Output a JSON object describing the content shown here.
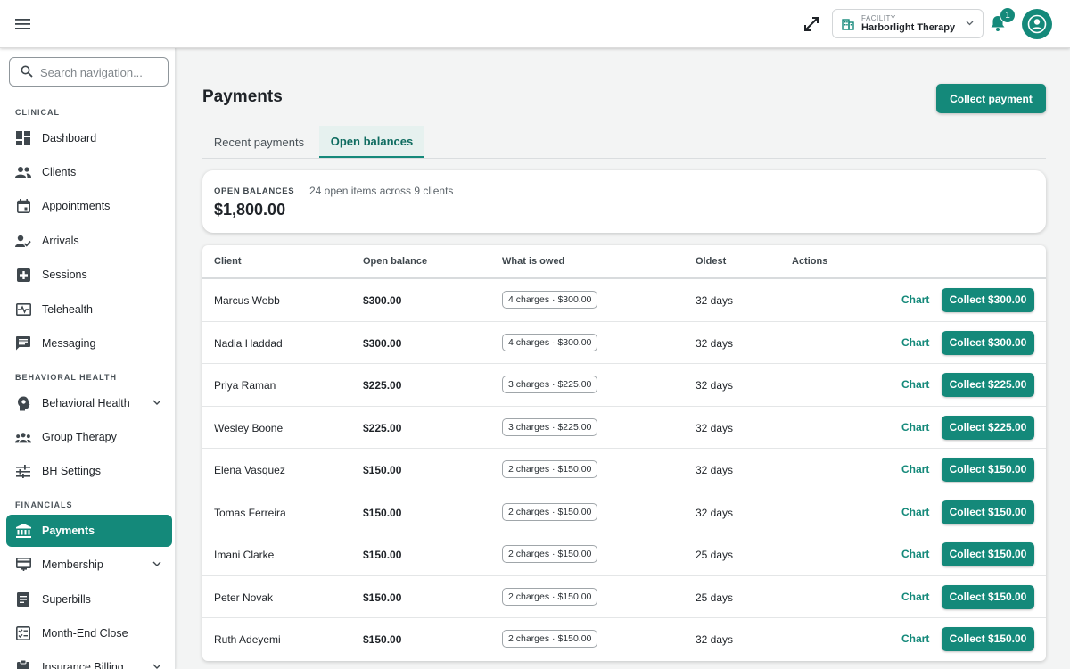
{
  "topbar": {
    "facility_label": "FACILITY",
    "facility_name": "Harborlight Therapy",
    "notification_count": "1"
  },
  "sidebar": {
    "search_placeholder": "Search navigation...",
    "sections": {
      "clinical": "CLINICAL",
      "behavioral_health": "BEHAVIORAL HEALTH",
      "financials": "FINANCIALS"
    },
    "items": [
      {
        "label": "Dashboard",
        "icon": "dashboard-icon"
      },
      {
        "label": "Clients",
        "icon": "people-icon"
      },
      {
        "label": "Appointments",
        "icon": "calendar-icon"
      },
      {
        "label": "Arrivals",
        "icon": "person-check-icon"
      },
      {
        "label": "Sessions",
        "icon": "medical-plus-icon"
      },
      {
        "label": "Telehealth",
        "icon": "monitor-pulse-icon"
      },
      {
        "label": "Messaging",
        "icon": "chat-icon"
      },
      {
        "label": "Behavioral Health",
        "icon": "head-icon"
      },
      {
        "label": "Group Therapy",
        "icon": "group-icon"
      },
      {
        "label": "BH Settings",
        "icon": "sliders-icon"
      },
      {
        "label": "Payments",
        "icon": "bank-icon"
      },
      {
        "label": "Membership",
        "icon": "card-icon"
      },
      {
        "label": "Superbills",
        "icon": "document-icon"
      },
      {
        "label": "Month-End Close",
        "icon": "checklist-icon"
      },
      {
        "label": "Insurance Billing",
        "icon": "clipboard-icon"
      }
    ],
    "active_item": "Payments"
  },
  "main": {
    "title": "Payments",
    "collect_payment_label": "Collect payment",
    "tabs": [
      {
        "label": "Recent payments"
      },
      {
        "label": "Open balances"
      }
    ],
    "active_tab": "Open balances",
    "summary": {
      "label": "OPEN BALANCES",
      "description": "24 open items across 9 clients",
      "amount": "$1,800.00"
    },
    "table": {
      "headers": [
        "Client",
        "Open balance",
        "What is owed",
        "Oldest",
        "Actions"
      ],
      "rows": [
        {
          "client": "Marcus Webb",
          "balance": "$300.00",
          "owed": "4 charges · $300.00",
          "oldest": "32 days",
          "chart": "Chart",
          "collect": "Collect $300.00"
        },
        {
          "client": "Nadia Haddad",
          "balance": "$300.00",
          "owed": "4 charges · $300.00",
          "oldest": "32 days",
          "chart": "Chart",
          "collect": "Collect $300.00"
        },
        {
          "client": "Priya Raman",
          "balance": "$225.00",
          "owed": "3 charges · $225.00",
          "oldest": "32 days",
          "chart": "Chart",
          "collect": "Collect $225.00"
        },
        {
          "client": "Wesley Boone",
          "balance": "$225.00",
          "owed": "3 charges · $225.00",
          "oldest": "32 days",
          "chart": "Chart",
          "collect": "Collect $225.00"
        },
        {
          "client": "Elena Vasquez",
          "balance": "$150.00",
          "owed": "2 charges · $150.00",
          "oldest": "32 days",
          "chart": "Chart",
          "collect": "Collect $150.00"
        },
        {
          "client": "Tomas Ferreira",
          "balance": "$150.00",
          "owed": "2 charges · $150.00",
          "oldest": "32 days",
          "chart": "Chart",
          "collect": "Collect $150.00"
        },
        {
          "client": "Imani Clarke",
          "balance": "$150.00",
          "owed": "2 charges · $150.00",
          "oldest": "25 days",
          "chart": "Chart",
          "collect": "Collect $150.00"
        },
        {
          "client": "Peter Novak",
          "balance": "$150.00",
          "owed": "2 charges · $150.00",
          "oldest": "25 days",
          "chart": "Chart",
          "collect": "Collect $150.00"
        },
        {
          "client": "Ruth Adeyemi",
          "balance": "$150.00",
          "owed": "2 charges · $150.00",
          "oldest": "32 days",
          "chart": "Chart",
          "collect": "Collect $150.00"
        }
      ]
    }
  },
  "colors": {
    "accent": "#14897a",
    "accent_tint": "#e6f1ef"
  }
}
